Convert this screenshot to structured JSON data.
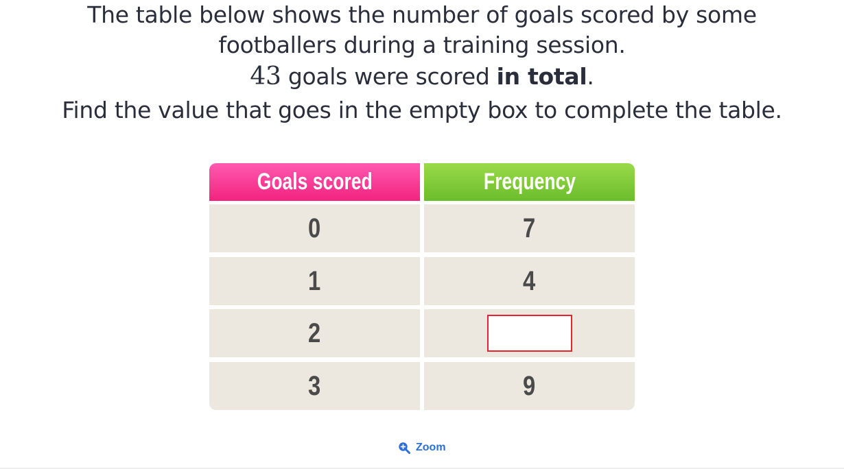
{
  "question": {
    "line1": "The table below shows the number of goals scored by some",
    "line2": "footballers during a training session.",
    "line3_number": "43",
    "line3_middle": " goals were scored ",
    "line3_bold": "in total",
    "line3_end": ".",
    "line4": "Find the value that goes in the empty box to complete the table."
  },
  "table": {
    "headers": [
      "Goals scored",
      "Frequency"
    ],
    "rows": [
      {
        "goals": "0",
        "frequency": "7"
      },
      {
        "goals": "1",
        "frequency": "4"
      },
      {
        "goals": "2",
        "frequency": ""
      },
      {
        "goals": "3",
        "frequency": "9"
      }
    ],
    "header_colors": {
      "goals": "#f2237f",
      "frequency": "#6bbd2c"
    },
    "cell_color": "#ece8df",
    "answer_box_border": "#e8222e"
  },
  "zoom": {
    "label": "Zoom",
    "icon": "zoom-in-icon",
    "color": "#2b6fdb"
  }
}
